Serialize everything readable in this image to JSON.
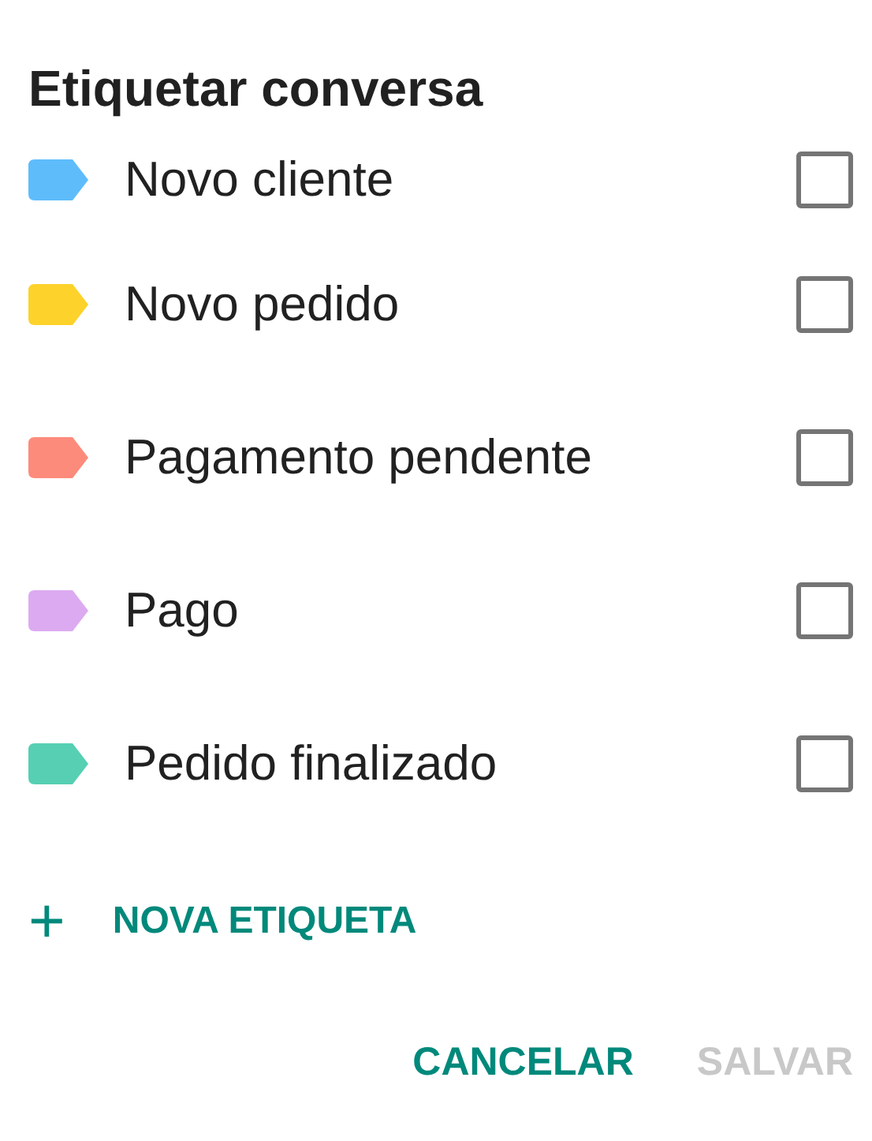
{
  "dialog": {
    "title": "Etiquetar conversa"
  },
  "labels": [
    {
      "name": "Novo cliente",
      "color": "#5ebcfb",
      "checked": false
    },
    {
      "name": "Novo pedido",
      "color": "#fdd22a",
      "checked": false
    },
    {
      "name": "Pagamento pendente",
      "color": "#fd8b7b",
      "checked": false
    },
    {
      "name": "Pago",
      "color": "#dcaaf1",
      "checked": false
    },
    {
      "name": "Pedido finalizado",
      "color": "#56cfb3",
      "checked": false
    }
  ],
  "new_label": {
    "icon": "+",
    "label": "NOVA ETIQUETA"
  },
  "buttons": [
    {
      "label": "CANCELAR",
      "disabled": false
    },
    {
      "label": "SALVAR",
      "disabled": true
    }
  ]
}
